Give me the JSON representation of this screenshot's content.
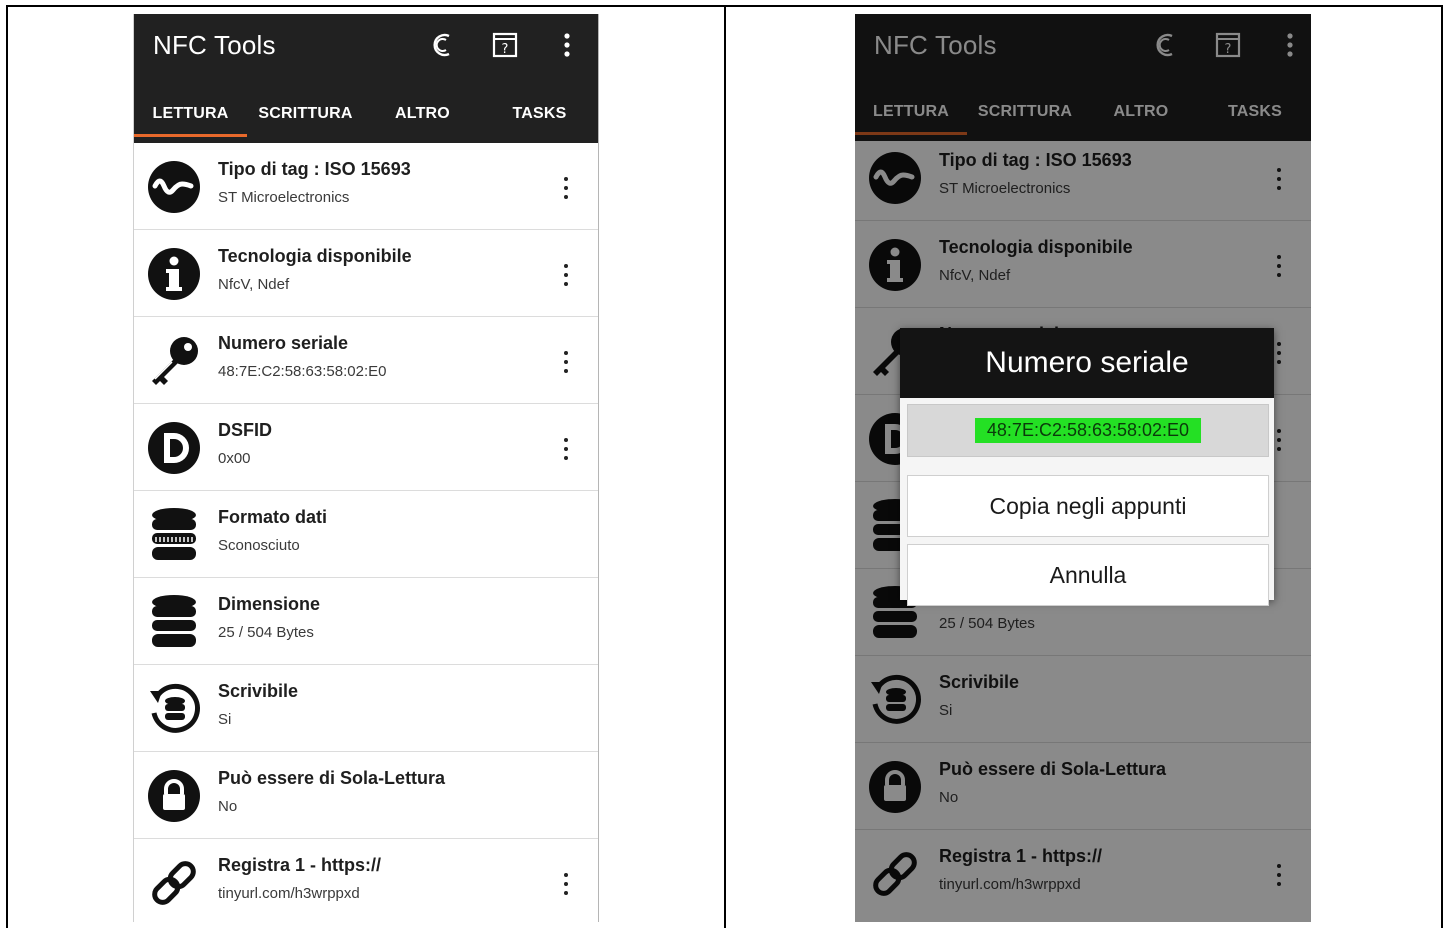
{
  "app": {
    "title": "NFC Tools",
    "tabs": [
      "LETTURA",
      "SCRITTURA",
      "ALTRO",
      "TASKS"
    ],
    "accent_color": "#e8692b",
    "header_color": "#212121"
  },
  "icons": {
    "history": "crescent-c-icon",
    "help": "question-box-icon",
    "menu": "more-vert-icon"
  },
  "rows": [
    {
      "title": "Tipo di tag : ISO 15693",
      "sub": "ST Microelectronics",
      "icon": "wave-icon",
      "menu": true
    },
    {
      "title": "Tecnologia disponibile",
      "sub": "NfcV, Ndef",
      "icon": "info-icon",
      "menu": true
    },
    {
      "title": "Numero seriale",
      "sub": "48:7E:C2:58:63:58:02:E0",
      "icon": "key-icon",
      "menu": true
    },
    {
      "title": "DSFID",
      "sub": "0x00",
      "icon": "d-letter-icon",
      "menu": true
    },
    {
      "title": "Formato dati",
      "sub": "Sconosciuto",
      "icon": "database-icon",
      "menu": false
    },
    {
      "title": "Dimensione",
      "sub": "25 / 504 Bytes",
      "icon": "database-icon",
      "menu": false
    },
    {
      "title": "Scrivibile",
      "sub": "Si",
      "icon": "database-refresh-icon",
      "menu": false
    },
    {
      "title": "Può essere di Sola-Lettura",
      "sub": "No",
      "icon": "lock-icon",
      "menu": false
    },
    {
      "title": "Registra 1 - https://",
      "sub": "tinyurl.com/h3wrppxd",
      "icon": "link-icon",
      "menu": true
    }
  ],
  "dialog": {
    "title": "Numero seriale",
    "value": "48:7E:C2:58:63:58:02:E0",
    "value_highlight": "#24e024",
    "copy_label": "Copia negli appunti",
    "cancel_label": "Annulla"
  }
}
